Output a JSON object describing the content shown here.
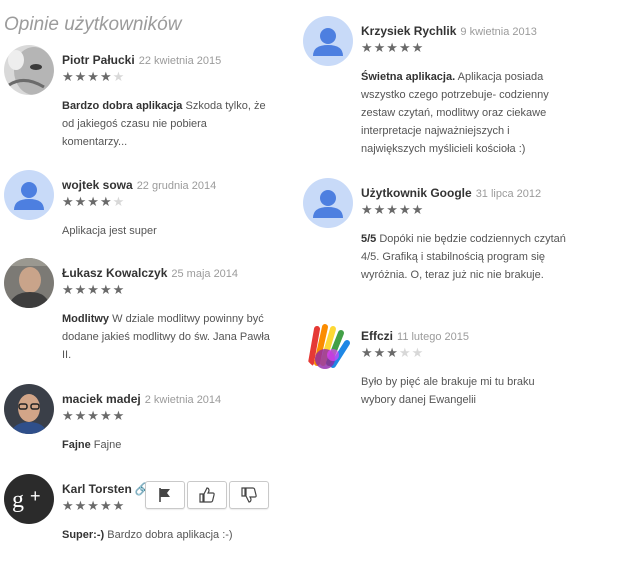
{
  "heading": "Opinie użytkowników",
  "colors": {
    "default_avatar_bg": "#c8daf8",
    "default_avatar_fg": "#4d7fe0",
    "gplus_bg": "#2b2b2b"
  },
  "reviews": [
    {
      "name": "Piotr Pałucki",
      "date": "22 kwietnia 2015",
      "rating": 4,
      "title": "Bardzo dobra aplikacja",
      "text": "Szkoda tylko, że od jakiegoś czasu nie pobiera komentarzy...",
      "avatar": "photo-face-icon"
    },
    {
      "name": "wojtek sowa",
      "date": "22 grudnia 2014",
      "rating": 4,
      "title": "",
      "text": "Aplikacja jest super",
      "avatar": "default-user-icon"
    },
    {
      "name": "Łukasz Kowalczyk",
      "date": "25 maja 2014",
      "rating": 5,
      "title": "Modlitwy",
      "text": "W dziale modlitwy powinny być dodane jakieś modlitwy do św. Jana Pawła II.",
      "avatar": "photo-man-icon"
    },
    {
      "name": "maciek madej",
      "date": "2 kwietnia 2014",
      "rating": 5,
      "title": "Fajne",
      "text": "Fajne",
      "avatar": "photo-glasses-icon"
    },
    {
      "name": "Karl Torsten",
      "date": "",
      "rating": 5,
      "title": "Super:-)",
      "text": "Bardzo dobra aplikacja :-)",
      "avatar": "google-plus-icon"
    },
    {
      "name": "Krzysiek Rychlik",
      "date": "9 kwietnia 2013",
      "rating": 5,
      "title": "Świetna aplikacja.",
      "text": "Aplikacja posiada wszystko czego potrzebuje- codzienny zestaw czytań, modlitwy oraz ciekawe interpretacje najważniejszych i największych myślicieli kościoła :)",
      "avatar": "default-user-icon"
    },
    {
      "name": "Użytkownik Google",
      "date": "31 lipca 2012",
      "rating": 5,
      "title": "5/5",
      "text": "Dopóki nie będzie codziennych czytań 4/5. Grafiką i stabilnością program się wyróżnia. O, teraz już nic nie brakuje.",
      "avatar": "default-user-icon"
    },
    {
      "name": "Effczi",
      "date": "11 lutego 2015",
      "rating": 3,
      "title": "",
      "text": "Było by pięć ale brakuje mi tu braku wybory danej Ewangelii",
      "avatar": "rainbow-hand-icon"
    }
  ],
  "actions": {
    "flag": "flag-icon",
    "like": "thumbs-up-icon",
    "dislike": "thumbs-down-icon"
  }
}
